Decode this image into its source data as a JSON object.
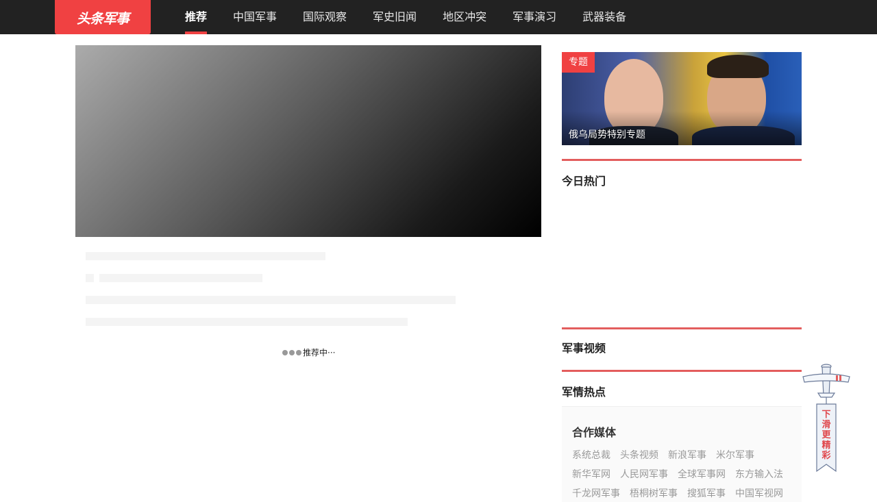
{
  "logo": {
    "text": "头条军事"
  },
  "nav": {
    "items": [
      {
        "label": "推荐",
        "active": true
      },
      {
        "label": "中国军事"
      },
      {
        "label": "国际观察"
      },
      {
        "label": "军史旧闻"
      },
      {
        "label": "地区冲突"
      },
      {
        "label": "军事演习"
      },
      {
        "label": "武器装备"
      }
    ]
  },
  "feed": {
    "loading_text": "推荐中···"
  },
  "topic": {
    "tag": "专题",
    "title": "俄乌局势特别专题"
  },
  "sections": {
    "hot_today": "今日热门",
    "military_video": "军事视频",
    "military_hot": "军情热点"
  },
  "partners": {
    "title": "合作媒体",
    "rows": [
      [
        "系统总裁",
        "头条视频",
        "新浪军事",
        "米尔军事"
      ],
      [
        "新华军网",
        "人民网军事",
        "全球军事网",
        "东方输入法"
      ],
      [
        "千龙网军事",
        "梧桐树军事",
        "搜狐军事",
        "中国军视网"
      ]
    ]
  },
  "scroll_widget": {
    "text": "下滑更精彩"
  },
  "colors": {
    "accent": "#f04142",
    "nav_bg": "#222222",
    "section_line": "#e35d5d"
  }
}
